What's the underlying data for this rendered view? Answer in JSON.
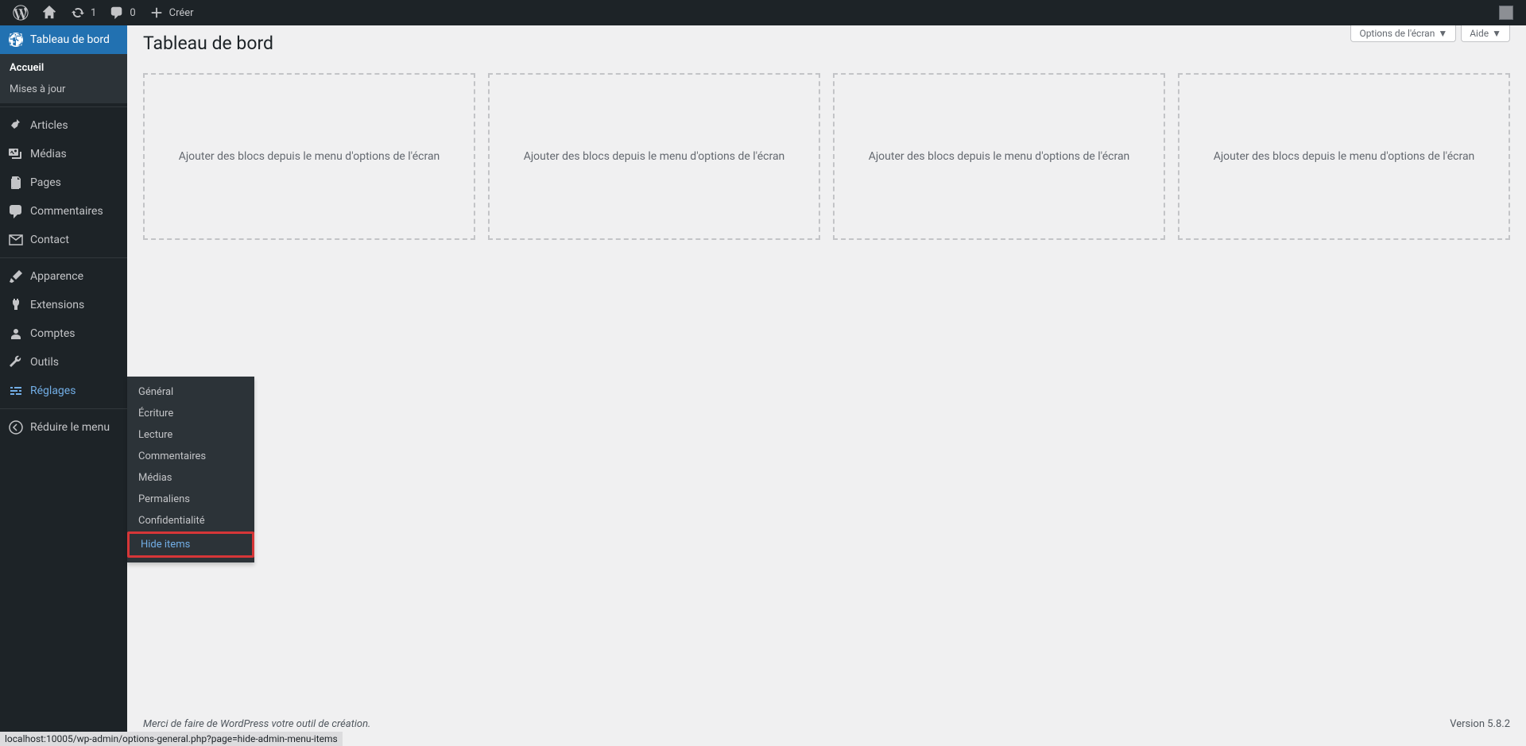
{
  "adminbar": {
    "updates_count": "1",
    "comments_count": "0",
    "create_label": "Créer"
  },
  "sidebar": {
    "dashboard": "Tableau de bord",
    "dashboard_sub": {
      "home": "Accueil",
      "updates": "Mises à jour"
    },
    "posts": "Articles",
    "media": "Médias",
    "pages": "Pages",
    "comments": "Commentaires",
    "contact": "Contact",
    "appearance": "Apparence",
    "plugins": "Extensions",
    "users": "Comptes",
    "tools": "Outils",
    "settings": "Réglages",
    "collapse": "Réduire le menu",
    "settings_sub": {
      "general": "Général",
      "writing": "Écriture",
      "reading": "Lecture",
      "discussion": "Commentaires",
      "media": "Médias",
      "permalinks": "Permaliens",
      "privacy": "Confidentialité",
      "hide_items": "Hide items"
    }
  },
  "screen": {
    "options": "Options de l'écran",
    "help": "Aide"
  },
  "page": {
    "title": "Tableau de bord",
    "placeholder_text": "Ajouter des blocs depuis le menu d'options de l'écran"
  },
  "footer": {
    "left": "Merci de faire de WordPress votre outil de création.",
    "right": "Version 5.8.2"
  },
  "statusbar": "localhost:10005/wp-admin/options-general.php?page=hide-admin-menu-items"
}
